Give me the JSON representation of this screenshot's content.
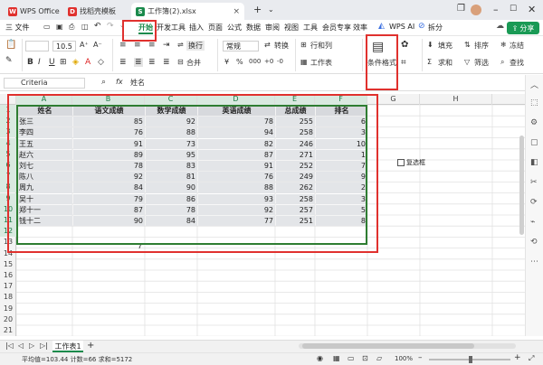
{
  "titlebar": {
    "tabs": [
      {
        "label": "WPS Office",
        "icon": "wps-logo-icon",
        "color": "#e0312e"
      },
      {
        "label": "找稻壳模板",
        "icon": "docer-icon",
        "color": "#e0312e"
      },
      {
        "label": "工作簿(2).xlsx",
        "icon": "sheet-icon",
        "color": "#1b8a4c"
      }
    ]
  },
  "menubar": {
    "file": "三 文件",
    "items": [
      "开始",
      "开发工具",
      "插入",
      "页面",
      "公式",
      "数据",
      "审阅",
      "视图",
      "工具",
      "会员专享",
      "效率"
    ],
    "active": "开始",
    "wps_ai": "WPS AI",
    "split": "拆分",
    "share": "分享"
  },
  "ribbon": {
    "font_name": "",
    "font_size": "10.5",
    "wrap": "换行",
    "merge": "合并",
    "number_format": "常规",
    "convert": "转换",
    "row_col": "行和列",
    "worksheet": "工作表",
    "cond_format": "条件格式",
    "fill": "填充",
    "sort": "排序",
    "freeze": "冻结",
    "sum": "求和",
    "filter": "筛选",
    "find": "查找"
  },
  "formula_bar": {
    "name_box": "Criteria",
    "fx": "fx",
    "content": "姓名"
  },
  "sheet": {
    "columns": [
      "A",
      "B",
      "C",
      "D",
      "E",
      "F",
      "G",
      "H"
    ],
    "rows": [
      "1",
      "2",
      "3",
      "4",
      "5",
      "6",
      "7",
      "8",
      "9",
      "10",
      "11",
      "12",
      "13",
      "14",
      "15",
      "16",
      "17",
      "18",
      "19",
      "20",
      "21"
    ],
    "headers": [
      "姓名",
      "语文成绩",
      "数学成绩",
      "英语成绩",
      "总成绩",
      "排名"
    ],
    "data": [
      [
        "张三",
        "85",
        "92",
        "78",
        "255",
        "6"
      ],
      [
        "李四",
        "76",
        "88",
        "94",
        "258",
        "3"
      ],
      [
        "王五",
        "91",
        "73",
        "82",
        "246",
        "10"
      ],
      [
        "赵六",
        "89",
        "95",
        "87",
        "271",
        "1"
      ],
      [
        "刘七",
        "78",
        "83",
        "91",
        "252",
        "7"
      ],
      [
        "陈八",
        "92",
        "81",
        "76",
        "249",
        "9"
      ],
      [
        "周九",
        "84",
        "90",
        "88",
        "262",
        "2"
      ],
      [
        "吴十",
        "79",
        "86",
        "93",
        "258",
        "3"
      ],
      [
        "郑十一",
        "87",
        "78",
        "92",
        "257",
        "5"
      ],
      [
        "钱十二",
        "90",
        "84",
        "77",
        "251",
        "8"
      ]
    ],
    "stray_value": "7",
    "checkbox_label": "复选框"
  },
  "sheet_tabs": {
    "active": "工作表1",
    "add": "+"
  },
  "statusbar": {
    "stats": "平均值=103.44  计数=66  求和=5172",
    "zoom": "100%"
  },
  "colors": {
    "accent": "#1b8a4c",
    "annotation_red": "#e0312e",
    "table_border": "#2e7d32"
  }
}
